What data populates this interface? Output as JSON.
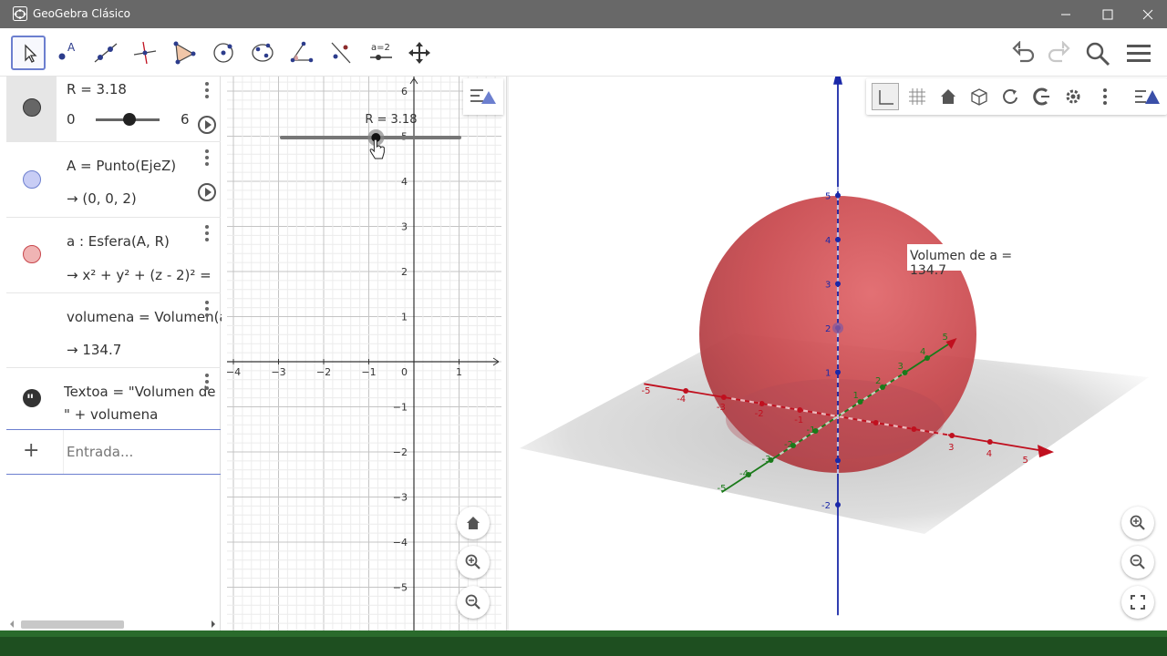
{
  "window": {
    "title": "GeoGebra Clásico"
  },
  "toolbar": {
    "tools": [
      {
        "name": "move-tool"
      },
      {
        "name": "point-tool"
      },
      {
        "name": "line-tool"
      },
      {
        "name": "perpendicular-tool"
      },
      {
        "name": "polygon-tool"
      },
      {
        "name": "circle-tool"
      },
      {
        "name": "conic-tool"
      },
      {
        "name": "angle-tool"
      },
      {
        "name": "reflect-tool"
      },
      {
        "name": "slider-tool",
        "label": "a=2"
      },
      {
        "name": "move-view-tool"
      }
    ]
  },
  "algebra": {
    "slider": {
      "def": "R = 3.18",
      "min": "0",
      "max": "6",
      "value": 3.18,
      "fraction": 0.53
    },
    "point": {
      "def": "A = Punto(EjeZ)",
      "value": "→  (0, 0, 2)"
    },
    "sphere": {
      "def": "a : Esfera(A, R)",
      "value": "→  x² + y² + (z - 2)² ="
    },
    "volume": {
      "def": "volumena = Volumen(a)",
      "value": "→  134.7"
    },
    "text": {
      "def": "Textoa = \"Volumen de",
      "def2": "\" + volumena"
    },
    "input_placeholder": "Entrada..."
  },
  "graphics2d": {
    "slider_label": "R = 3.18",
    "y_ticks": [
      "6",
      "5",
      "4",
      "3",
      "2",
      "1",
      "0",
      "−1",
      "−2",
      "−3",
      "−4",
      "−5"
    ],
    "x_ticks": [
      "−4",
      "−3",
      "−2",
      "−1",
      "1"
    ]
  },
  "graphics3d": {
    "volume_label": "Volumen de a = 134.7",
    "sphere_color": "#c8464b"
  },
  "colors": {
    "accent": "#6c7fcf",
    "slider_marble": "#666666",
    "point_marble": "#c8cdf5",
    "sphere_marble": "#f0b4b4",
    "x_axis": "#c0101f",
    "y_axis": "#1a7a1a",
    "z_axis": "#1a28a8"
  }
}
